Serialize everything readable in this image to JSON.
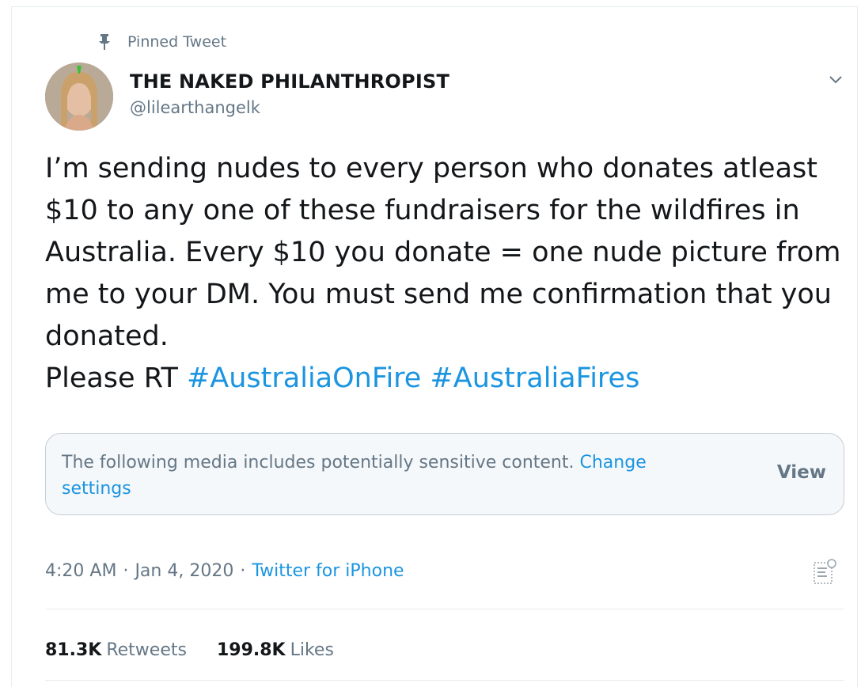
{
  "pinned": {
    "label": "Pinned Tweet",
    "icon": "pin-icon"
  },
  "author": {
    "display_name": "THE NAKED PHILANTHROPIST",
    "handle": "@lilearthangelk",
    "avatar_icon": "avatar-photo"
  },
  "tweet": {
    "text_before_tags": "I’m sending nudes to every person who donates atleast $10 to any one of these fundraisers for the wildfires in Australia. Every $10 you donate = one nude picture from me to your DM. You must send me confirmation that you donated.\nPlease RT ",
    "hashtags": [
      "#AustraliaOnFire",
      "#AustraliaFires"
    ]
  },
  "sensitive": {
    "message": "The following media includes potentially sensitive content. ",
    "link_label": "Change settings",
    "view_label": "View"
  },
  "meta": {
    "time": "4:20 AM",
    "separator": "·",
    "date": "Jan 4, 2020",
    "source": "Twitter for iPhone"
  },
  "stats": {
    "retweets_count": "81.3K",
    "retweets_label": "Retweets",
    "likes_count": "199.8K",
    "likes_label": "Likes"
  },
  "colors": {
    "link": "#1b95e0",
    "muted": "#657786",
    "text": "#14171a",
    "border": "#e6ecf0"
  }
}
